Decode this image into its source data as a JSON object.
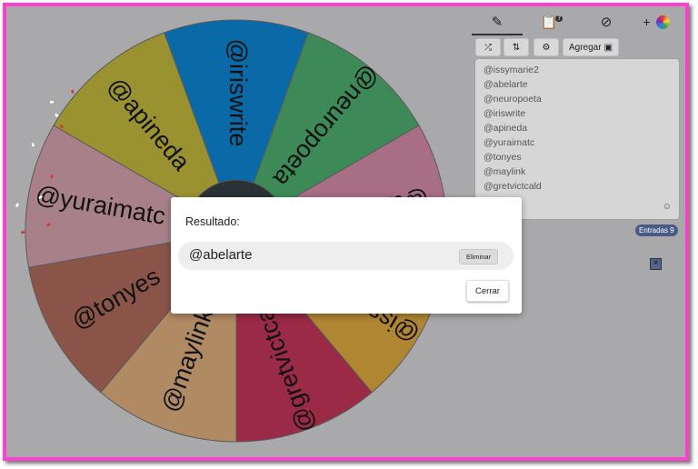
{
  "wheel": {
    "segments": [
      {
        "label": "@iriswrite",
        "color": "#0a6aa8"
      },
      {
        "label": "@neuropoeta",
        "color": "#3d8a58"
      },
      {
        "label": "@abelarte",
        "color": "#a76e84"
      },
      {
        "label": "@issymarie2",
        "color": "#b08632"
      },
      {
        "label": "@gretvictcald",
        "color": "#9a2a46"
      },
      {
        "label": "@maylink",
        "color": "#b08a63"
      },
      {
        "label": "@tonyes",
        "color": "#8a5449"
      },
      {
        "label": "@yuraimatc",
        "color": "#a8808a"
      },
      {
        "label": "@apineda",
        "color": "#9a9130"
      }
    ]
  },
  "panel": {
    "tabs": [
      {
        "icon": "pencil-icon",
        "active": true
      },
      {
        "icon": "clipboard-icon",
        "badge": "7"
      },
      {
        "icon": "eye-slash-icon"
      }
    ],
    "add_label": "+",
    "toolbar": {
      "shuffle_icon": "shuffle-icon",
      "sort_icon": "sort-icon",
      "settings_icon": "gear-icon",
      "add_image_label": "Agregar"
    },
    "entries": [
      "@issymarie2",
      "@abelarte",
      "@neuropoeta",
      "@iriswrite",
      "@apineda",
      "@yuraimatc",
      "@tonyes",
      "@maylink",
      "@gretvictcald"
    ],
    "count_label": "Entradas",
    "count_value": "9"
  },
  "modal": {
    "title": "Resultado:",
    "result": "@abelarte",
    "remove_label": "Eliminar",
    "close_label": "Cerrar"
  },
  "colors": {
    "frame": "#ff3fd0",
    "overlay": "#a9a9ab"
  }
}
